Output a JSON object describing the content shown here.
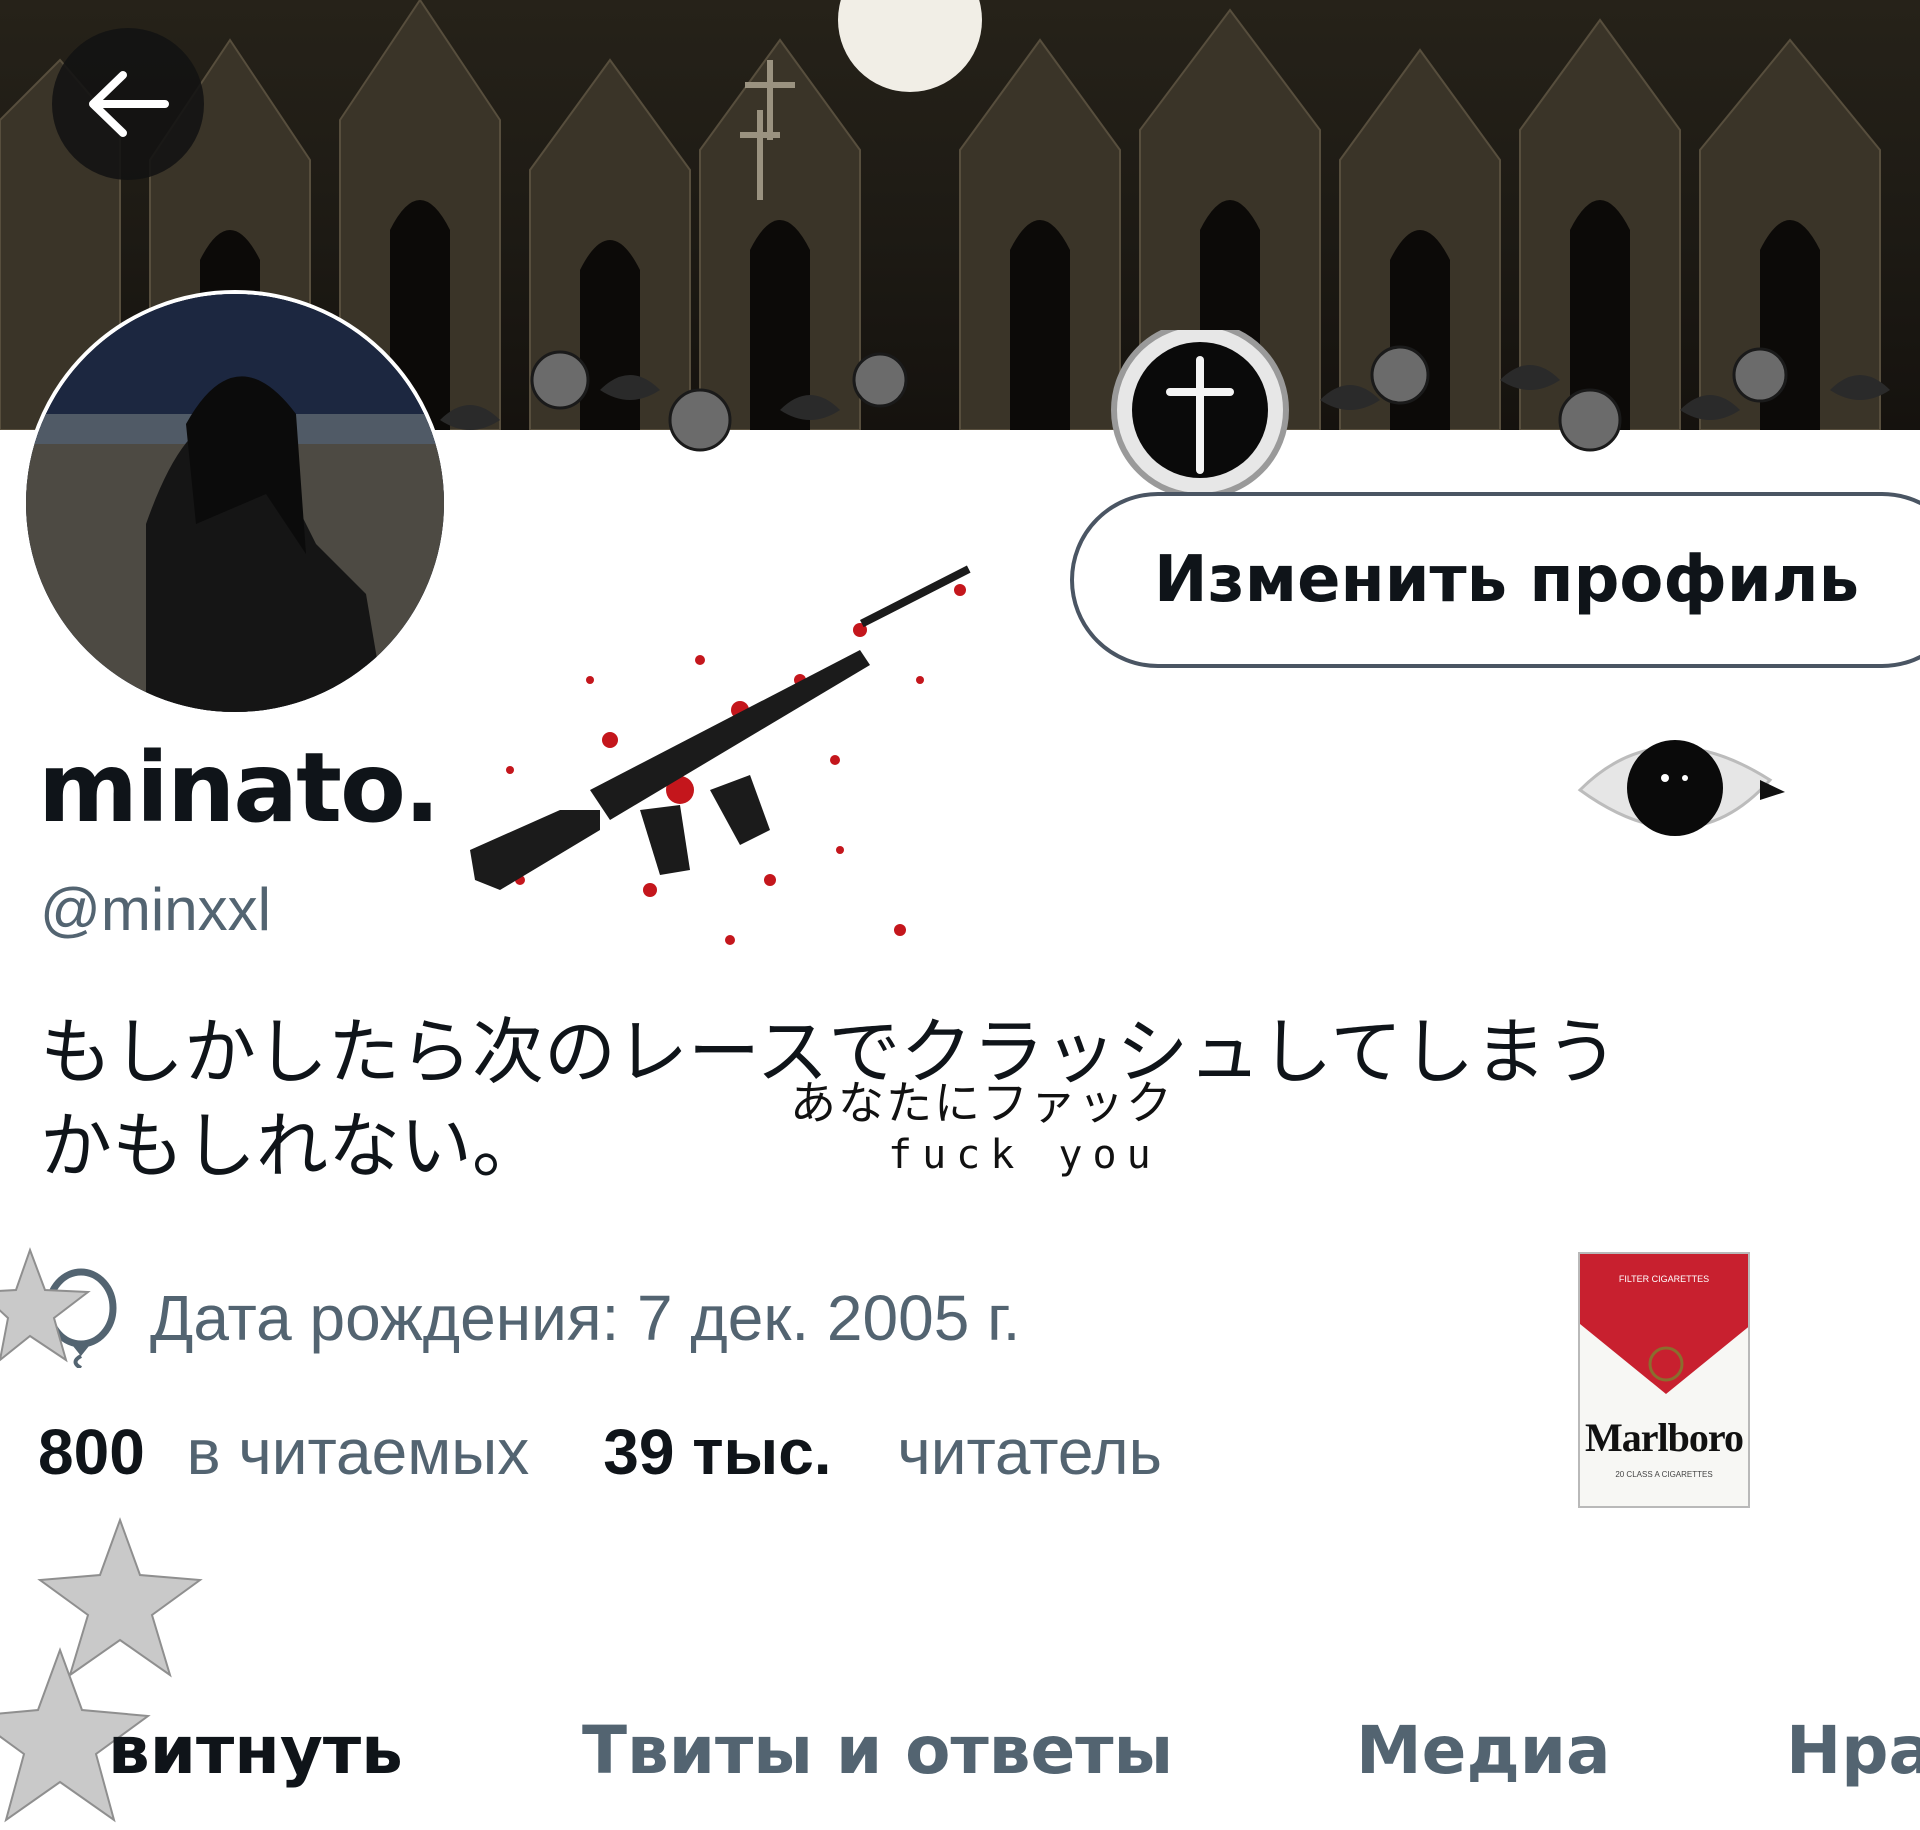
{
  "header": {
    "back_icon": "arrow-left-icon",
    "edit_profile_label": "Изменить профиль"
  },
  "profile": {
    "display_name": "minato.",
    "handle": "@minxxl",
    "bio_line1": "もしかしたら次のレースでクラッシュしてしまう",
    "bio_line2": "かもしれない。",
    "birth_icon": "balloon-icon",
    "birth_text": "Дата рождения: 7 дек. 2005 г.",
    "following_count": "800",
    "following_label": "в читаемых",
    "followers_count": "39 тыс.",
    "followers_label": "читатель"
  },
  "stickers": {
    "jp_text": "あなたにファック",
    "en_text": "fuck you",
    "cig_top_label": "FILTER CIGARETTES",
    "cig_brand": "Marlboro",
    "cig_bottom_label": "20 CLASS A CIGARETTES"
  },
  "tabs": [
    {
      "label": "витнуть"
    },
    {
      "label": "Твиты и ответы"
    },
    {
      "label": "Медиа"
    },
    {
      "label": "Нра"
    }
  ],
  "colors": {
    "text_primary": "#0f1419",
    "text_secondary": "#536471",
    "blood": "#c4161c",
    "marlboro_red": "#c8202f"
  }
}
